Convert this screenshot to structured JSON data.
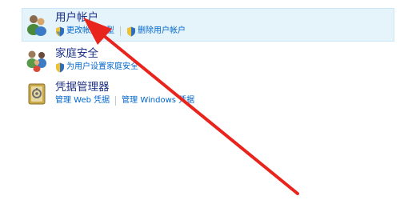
{
  "categories": [
    {
      "title": "用户帐户",
      "links": [
        {
          "label": "更改帐户类型",
          "icon": "uac-shield-icon"
        },
        {
          "label": "删除用户帐户",
          "icon": "uac-shield-icon"
        }
      ],
      "icon": "user-accounts-icon",
      "selected": true
    },
    {
      "title": "家庭安全",
      "links": [
        {
          "label": "为用户设置家庭安全",
          "icon": "uac-shield-icon"
        }
      ],
      "icon": "family-safety-icon"
    },
    {
      "title": "凭据管理器",
      "links": [
        {
          "label": "管理 Web 凭据"
        },
        {
          "label": "管理 Windows 凭据"
        }
      ],
      "icon": "credential-manager-icon"
    }
  ],
  "colors": {
    "title": "#1e3287",
    "link": "#0066cc",
    "selected_bg": "#e5f3fb",
    "arrow": "#e8241d"
  }
}
